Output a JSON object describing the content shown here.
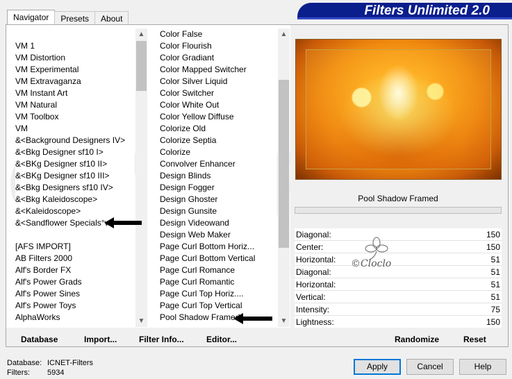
{
  "window": {
    "title": "Filters Unlimited 2.0"
  },
  "tabs": [
    {
      "label": "Navigator",
      "active": true
    },
    {
      "label": "Presets",
      "active": false
    },
    {
      "label": "About",
      "active": false
    }
  ],
  "category_list": {
    "items": [
      "VM 1",
      "VM Distortion",
      "VM Experimental",
      "VM Extravaganza",
      "VM Instant Art",
      "VM Natural",
      "VM Toolbox",
      "VM",
      "&<Background Designers IV>",
      "&<Bkg Designer sf10 I>",
      "&<BKg Designer sf10 II>",
      "&<BKg Designer sf10 III>",
      "&<Bkg Designers sf10 IV>",
      "&<Bkg Kaleidoscope>",
      "&<Kaleidoscope>",
      "&<Sandflower Specials°v°>",
      "",
      "[AFS IMPORT]",
      "AB Filters 2000",
      "Alf's Border FX",
      "Alf's Power Grads",
      "Alf's Power Sines",
      "Alf's Power Toys",
      "AlphaWorks"
    ],
    "selected": "&<Sandflower Specials°v°>"
  },
  "filter_list": {
    "items": [
      "Color False",
      "Color Flourish",
      "Color Gradiant",
      "Color Mapped Switcher",
      "Color Silver Liquid",
      "Color Switcher",
      "Color White Out",
      "Color Yellow Diffuse",
      "Colorize Old",
      "Colorize Septia",
      "Colorize",
      "Convolver Enhancer",
      "Design Blinds",
      "Design Fogger",
      "Design Ghoster",
      "Design Gunsite",
      "Design Videowand",
      "Design Web Maker",
      "Page Curl Bottom Horiz...",
      "Page Curl Bottom Vertical",
      "Page Curl Romance",
      "Page Curl Romantic",
      "Page Curl Top Horiz....",
      "Page Curl Top Vertical",
      "Pool Shadow Framed"
    ],
    "selected": "Pool Shadow Framed"
  },
  "preview": {
    "filter_name": "Pool Shadow Framed",
    "progress": 0
  },
  "params": [
    {
      "label": "Diagonal:",
      "value": "150"
    },
    {
      "label": "Center:",
      "value": "150"
    },
    {
      "label": "Horizontal:",
      "value": "51"
    },
    {
      "label": "Diagonal:",
      "value": "51"
    },
    {
      "label": "Horizontal:",
      "value": "51"
    },
    {
      "label": "Vertical:",
      "value": "51"
    },
    {
      "label": "Intensity:",
      "value": "75"
    },
    {
      "label": "Lightness:",
      "value": "150"
    }
  ],
  "toolbar": {
    "database": "Database",
    "import": "Import...",
    "filter_info": "Filter Info...",
    "editor": "Editor...",
    "randomize": "Randomize",
    "reset": "Reset"
  },
  "status": {
    "database_label": "Database:",
    "database_value": "ICNET-Filters",
    "filters_label": "Filters:",
    "filters_value": "5934"
  },
  "buttons": {
    "apply": "Apply",
    "cancel": "Cancel",
    "help": "Help"
  },
  "watermark": {
    "signature": "©Cloclo"
  },
  "colors": {
    "banner": "#0a1e8c",
    "default_button_border": "#0078d7"
  }
}
